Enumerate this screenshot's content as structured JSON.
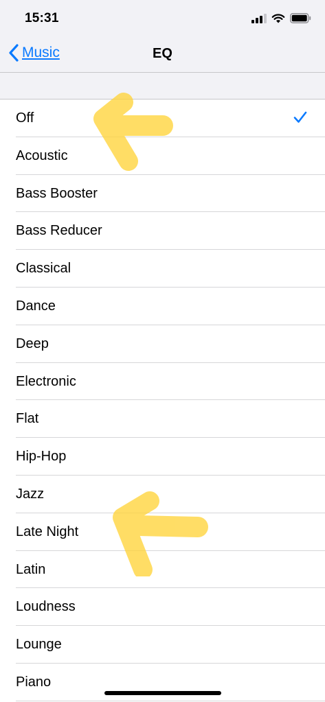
{
  "status_bar": {
    "time": "15:31",
    "icons": [
      "cellular-signal-icon",
      "wifi-icon",
      "battery-icon"
    ]
  },
  "nav": {
    "back_label": "Music",
    "title": "EQ"
  },
  "eq_options": [
    {
      "label": "Off",
      "selected": true
    },
    {
      "label": "Acoustic",
      "selected": false
    },
    {
      "label": "Bass Booster",
      "selected": false
    },
    {
      "label": "Bass Reducer",
      "selected": false
    },
    {
      "label": "Classical",
      "selected": false
    },
    {
      "label": "Dance",
      "selected": false
    },
    {
      "label": "Deep",
      "selected": false
    },
    {
      "label": "Electronic",
      "selected": false
    },
    {
      "label": "Flat",
      "selected": false
    },
    {
      "label": "Hip-Hop",
      "selected": false
    },
    {
      "label": "Jazz",
      "selected": false
    },
    {
      "label": "Late Night",
      "selected": false
    },
    {
      "label": "Latin",
      "selected": false
    },
    {
      "label": "Loudness",
      "selected": false
    },
    {
      "label": "Lounge",
      "selected": false
    },
    {
      "label": "Piano",
      "selected": false
    }
  ],
  "annotations": [
    {
      "icon": "highlighter-arrow-icon",
      "points_to": "Off"
    },
    {
      "icon": "highlighter-arrow-icon",
      "points_to": "Late Night"
    }
  ],
  "colors": {
    "accent": "#0a7aff",
    "highlighter": "#ffd43b",
    "bar_background": "#f2f2f6",
    "separator": "#d6d6d8"
  }
}
